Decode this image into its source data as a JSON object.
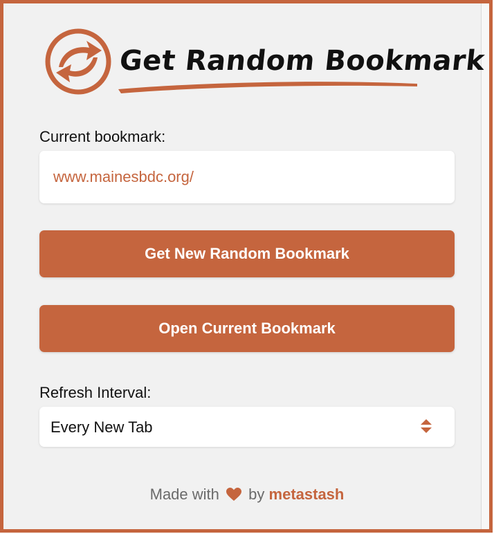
{
  "app": {
    "title": "Get Random Bookmark",
    "brand_color": "#c5653e",
    "logo_icon": "refresh-arrows-icon"
  },
  "current": {
    "label": "Current bookmark:",
    "url": "www.mainesbdc.org/"
  },
  "actions": {
    "new_label": "Get New Random Bookmark",
    "open_label": "Open Current Bookmark"
  },
  "interval": {
    "label": "Refresh Interval:",
    "selected": "Every New Tab",
    "icon": "select-arrows-icon"
  },
  "footer": {
    "made_with": "Made with",
    "heart_icon": "heart-icon",
    "by": "by",
    "author": "metastash"
  }
}
